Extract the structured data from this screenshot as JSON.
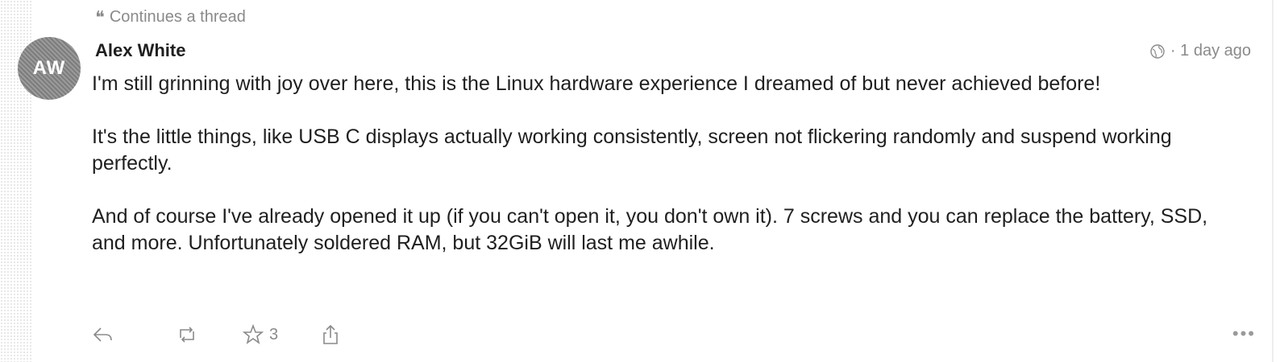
{
  "thread_note": {
    "icon": "quote-icon",
    "text": "Continues a thread"
  },
  "post": {
    "avatar_initials": "AW",
    "author": "Alex White",
    "visibility_icon": "globe-icon",
    "timestamp": "· 1 day ago",
    "paragraphs": [
      "I'm still grinning with joy over here, this is the Linux hardware experience I dreamed of but never achieved before!",
      "It's the little things, like USB C displays actually working consistently, screen not flickering randomly and suspend working perfectly.",
      "And of course I've already opened it up (if you can't open it, you don't own it). 7 screws and you can replace the battery, SSD, and more. Unfortunately soldered RAM, but 32GiB will last me awhile."
    ]
  },
  "actions": {
    "reply_icon": "reply-icon",
    "boost_icon": "boost-icon",
    "favourite_icon": "star-icon",
    "favourite_count": "3",
    "share_icon": "share-icon",
    "more_label": "•••"
  }
}
